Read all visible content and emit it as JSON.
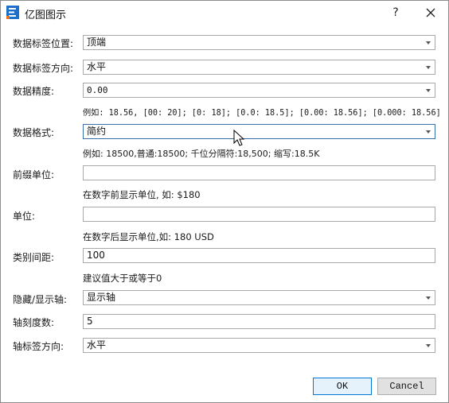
{
  "window": {
    "title": "亿图图示",
    "help_label": "?"
  },
  "form": {
    "label_position": {
      "label": "数据标签位置:",
      "value": "顶端"
    },
    "label_direction": {
      "label": "数据标签方向:",
      "value": "水平"
    },
    "precision": {
      "label": "数据精度:",
      "value": "0.00",
      "hint": "例如: 18.56, [00: 20]; [0: 18]; [0.0: 18.5]; [0.00: 18.56]; [0.000: 18.56]"
    },
    "format": {
      "label": "数据格式:",
      "value": "简约",
      "hint": "例如: 18500,普通:18500; 千位分隔符:18,500; 缩写:18.5K"
    },
    "prefix_unit": {
      "label": "前缀单位:",
      "value": "",
      "hint": "在数字前显示单位, 如: $180"
    },
    "unit": {
      "label": "单位:",
      "value": "",
      "hint": "在数字后显示单位,如: 180 USD"
    },
    "category_spacing": {
      "label": "类别间距:",
      "value": "100",
      "hint": "建议值大于或等于0"
    },
    "axis_visibility": {
      "label": "隐藏/显示轴:",
      "value": "显示轴"
    },
    "tick_count": {
      "label": "轴刻度数:",
      "value": "5"
    },
    "axis_label_direction": {
      "label": "轴标签方向:",
      "value": "水平"
    }
  },
  "buttons": {
    "ok": "OK",
    "cancel": "Cancel"
  },
  "colors": {
    "focus_border": "#3a6ea8",
    "ok_border": "#0078d7"
  }
}
